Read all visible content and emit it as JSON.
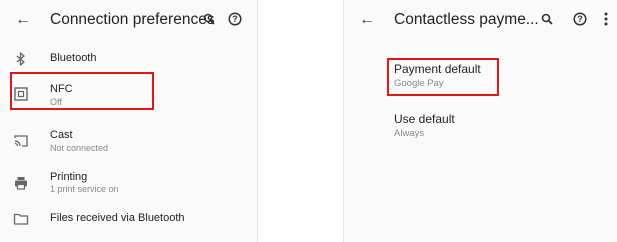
{
  "left": {
    "title": "Connection preferences",
    "icons": {
      "back": "arrow-back-icon",
      "search": "search-icon",
      "help": "help-icon"
    },
    "items": [
      {
        "title": "Bluetooth",
        "subtitle": "",
        "icon": "bluetooth-icon"
      },
      {
        "title": "NFC",
        "subtitle": "Off",
        "icon": "nfc-icon"
      },
      {
        "title": "Cast",
        "subtitle": "Not connected",
        "icon": "cast-icon"
      },
      {
        "title": "Printing",
        "subtitle": "1 print service on",
        "icon": "print-icon"
      },
      {
        "title": "Files received via Bluetooth",
        "subtitle": "",
        "icon": "folder-icon"
      }
    ]
  },
  "right": {
    "title": "Contactless payme...",
    "icons": {
      "back": "arrow-back-icon",
      "search": "search-icon",
      "help": "help-icon",
      "more": "more-vert-icon"
    },
    "items": [
      {
        "title": "Payment default",
        "subtitle": "Google Pay"
      },
      {
        "title": "Use default",
        "subtitle": "Always"
      }
    ]
  },
  "colors": {
    "highlight": "#e01818",
    "background": "#fafafa",
    "text": "#222222",
    "secondary": "#888888"
  }
}
